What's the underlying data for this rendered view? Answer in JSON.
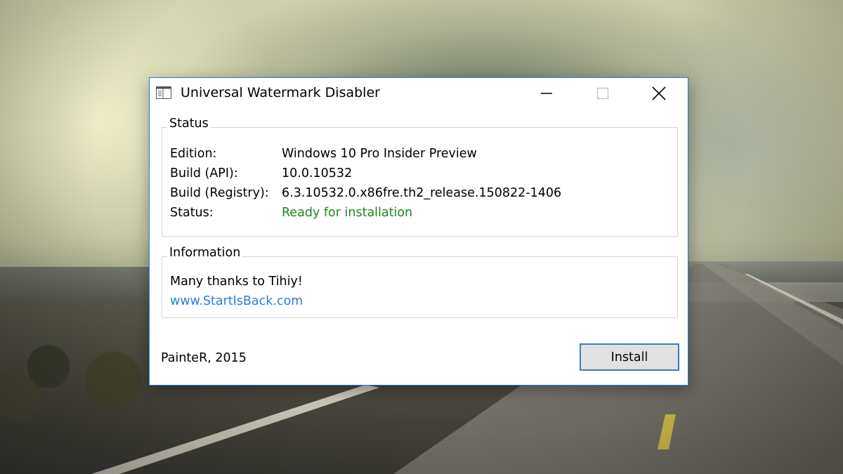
{
  "window": {
    "title": "Universal Watermark Disabler",
    "controls": {
      "minimize_icon": "minimize-icon",
      "maximize_icon": "maximize-icon",
      "close_icon": "close-icon"
    }
  },
  "status_group": {
    "legend": "Status",
    "rows": [
      {
        "label": "Edition:",
        "value": "Windows 10 Pro Insider Preview"
      },
      {
        "label": "Build (API):",
        "value": "10.0.10532"
      },
      {
        "label": "Build (Registry):",
        "value": "6.3.10532.0.x86fre.th2_release.150822-1406"
      },
      {
        "label": "Status:",
        "value": "Ready for installation"
      }
    ]
  },
  "info_group": {
    "legend": "Information",
    "thanks": "Many thanks to Tihiy!",
    "link": "www.StartIsBack.com"
  },
  "footer": {
    "credit": "PainteR, 2015",
    "install_label": "Install"
  },
  "colors": {
    "window_border": "#2b79d0",
    "status_ok": "#1a8a1a",
    "link": "#2a7fd6",
    "button_border": "#3d7bc4",
    "button_bg": "#e1e1e1"
  }
}
